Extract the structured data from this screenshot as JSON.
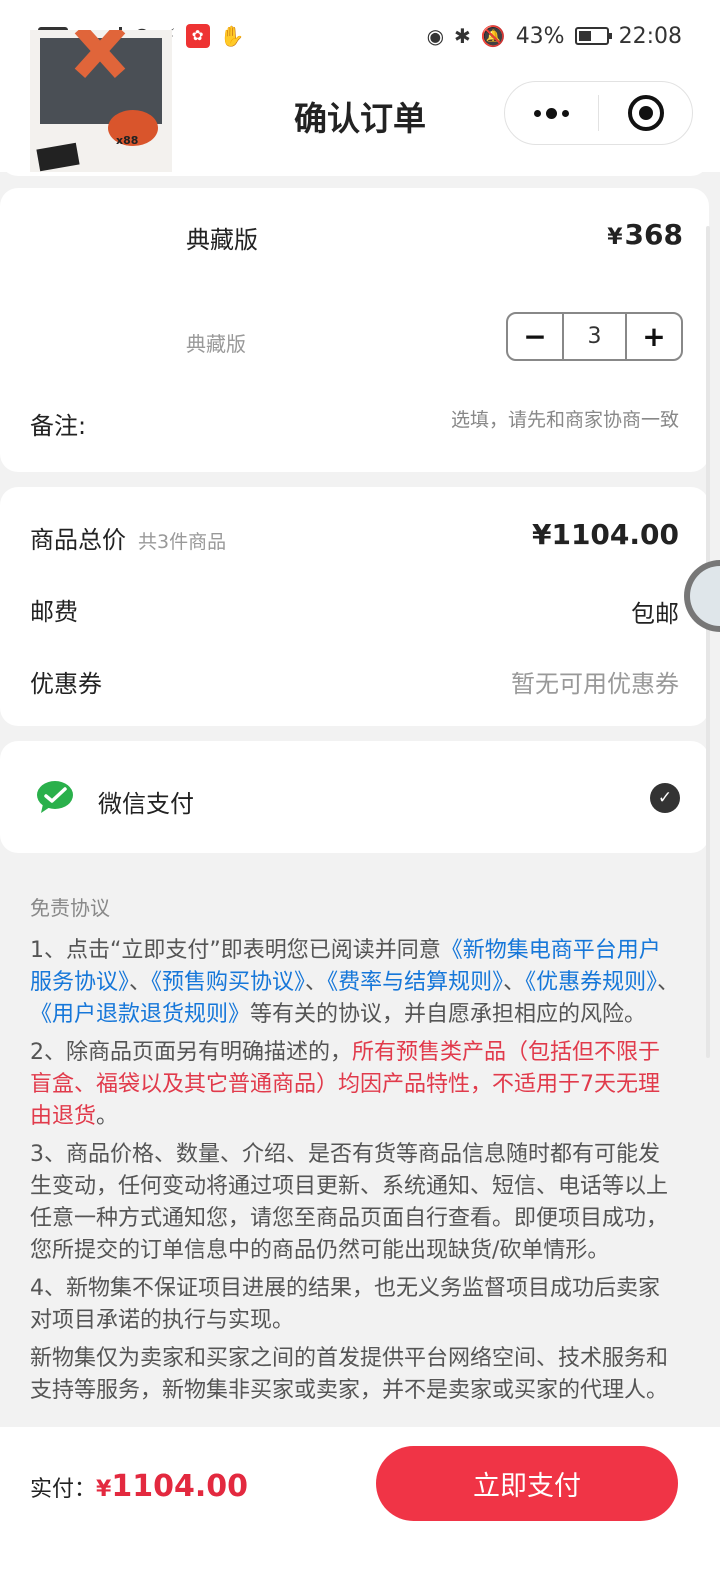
{
  "status_bar": {
    "left_hd": "HD",
    "left_net": "5G",
    "battery": "43%",
    "time": "22:08"
  },
  "nav": {
    "back": "‹",
    "title": "确认订单"
  },
  "product": {
    "name": "典藏版",
    "spec": "典藏版",
    "currency": "¥",
    "price": "368",
    "quantity": "3",
    "minus": "−",
    "plus": "+",
    "thumb_label": "x88"
  },
  "remark": {
    "label": "备注:",
    "placeholder": "选填，请先和商家协商一致"
  },
  "summary": {
    "total_label": "商品总价",
    "total_sub": "共3件商品",
    "total_value": "¥1104.00",
    "shipping_label": "邮费",
    "shipping_value": "包邮",
    "coupon_label": "优惠券",
    "coupon_value": "暂无可用优惠券"
  },
  "payment": {
    "method": "微信支付",
    "selected": "✓"
  },
  "disclaimer": {
    "title": "免责协议",
    "p1_a": "1、点击“立即支付”即表明您已阅读并同意",
    "link1": "《新物集电商平台用户服务协议》",
    "sep1": "、",
    "link2": "《预售购买协议》",
    "sep2": "、",
    "link3": "《费率与结算规则》",
    "sep3": "、",
    "link4": "《优惠券规则》",
    "sep4": "、",
    "link5": "《用户退款退货规则》",
    "p1_b": "等有关的协议，并自愿承担相应的风险。",
    "p2_a": "2、除商品页面另有明确描述的，",
    "p2_red": "所有预售类产品（包括但不限于盲盒、福袋以及其它普通商品）均因产品特性，不适用于7天无理由退货",
    "p2_b": "。",
    "p3": "3、商品价格、数量、介绍、是否有货等商品信息随时都有可能发生变动，任何变动将通过项目更新、系统通知、短信、电话等以上任意一种方式通知您，请您至商品页面自行查看。即便项目成功，您所提交的订单信息中的商品仍然可能出现缺货/砍单情形。",
    "p4": "4、新物集不保证项目进展的结果，也无义务监督项目成功后卖家对项目承诺的执行与实现。",
    "p5": "新物集仅为卖家和买家之间的首发提供平台网络空间、技术服务和支持等服务，新物集非买家或卖家，并不是卖家或买家的代理人。"
  },
  "footer": {
    "label": "实付：",
    "currency": "¥",
    "amount": "1104.00",
    "pay_button": "立即支付"
  },
  "colors": {
    "accent": "#f03446",
    "link": "#1677d9",
    "warning": "#e13a4b",
    "wechat_green": "#2ab04b"
  }
}
